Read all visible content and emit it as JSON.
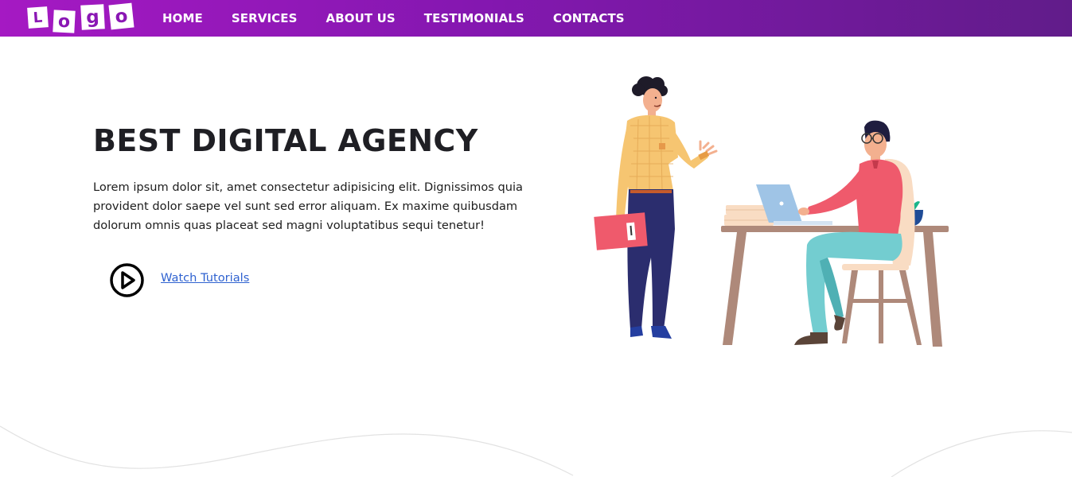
{
  "logo": {
    "letters": [
      "L",
      "o",
      "g",
      "o"
    ]
  },
  "nav": {
    "items": [
      "HOME",
      "SERVICES",
      "ABOUT US",
      "TESTIMONIALS",
      "CONTACTS"
    ]
  },
  "hero": {
    "title": "BEST DIGITAL AGENCY",
    "description": "Lorem ipsum dolor sit, amet consectetur adipisicing elit. Dignissimos quia provident dolor saepe vel sunt sed error aliquam. Ex maxime quibusdam dolorum omnis quas placeat sed magni voluptatibus sequi tenetur!",
    "watch_label": "Watch Tutorials",
    "play_icon": "play-circle-icon"
  },
  "colors": {
    "nav_gradient_start": "#a519c3",
    "nav_gradient_end": "#611c8a",
    "link": "#2f62d0",
    "title": "#1f1f24"
  }
}
